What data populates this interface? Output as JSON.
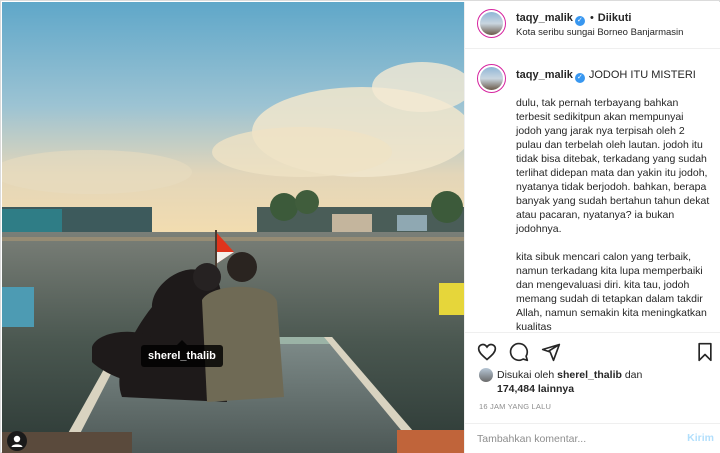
{
  "post": {
    "username": "taqy_malik",
    "verified": true,
    "follow_status": "Diikuti",
    "separator": "•",
    "location": "Kota seribu sungai Borneo Banjarmasin",
    "more_icon": "ellipsis-icon"
  },
  "photo": {
    "tag_label": "sherel_thalib",
    "description": "couple on boat deck on river at sunset"
  },
  "caption": {
    "username": "taqy_malik",
    "title": "JODOH ITU MISTERI",
    "body": "dulu, tak pernah terbayang bahkan terbesit sedikitpun akan mempunyai jodoh yang jarak nya terpisah oleh 2 pulau dan terbelah oleh lautan. jodoh itu tidak bisa ditebak, terkadang yang sudah terlihat didepan mata dan yakin itu jodoh, nyatanya tidak berjodoh. bahkan, berapa banyak yang sudah bertahun tahun dekat atau pacaran, nyatanya? ia bukan jodohnya.\n\nkita sibuk mencari calon yang terbaik, namun terkadang kita lupa memperbaiki dan mengevaluasi diri. kita tau, jodoh memang sudah di tetapkan dalam takdir Allah, namun semakin kita meningkatkan kualitas"
  },
  "actions": {
    "like_icon": "heart-icon",
    "comment_icon": "comment-icon",
    "share_icon": "share-icon",
    "save_icon": "bookmark-icon"
  },
  "likes": {
    "prefix": "Disukai oleh",
    "user": "sherel_thalib",
    "conj": "dan",
    "count": "174,484",
    "suffix": "lainnya"
  },
  "timestamp": "16 JAM YANG LALU",
  "comment": {
    "placeholder": "Tambahkan komentar...",
    "send_label": "Kirim"
  },
  "colors": {
    "verified_blue": "#3897f0",
    "send_disabled": "#b2dffc",
    "muted_text": "#8e8e8e"
  }
}
